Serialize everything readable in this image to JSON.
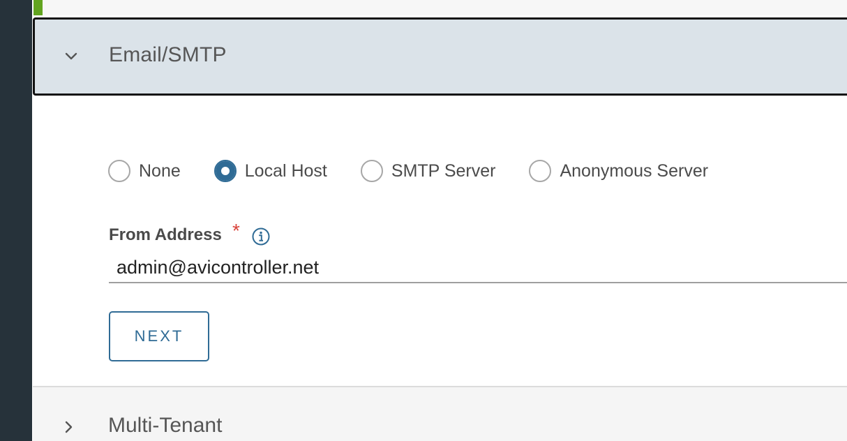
{
  "sections": {
    "email_smtp": {
      "title": "Email/SMTP",
      "expanded": true,
      "chevron_icon": "chevron-down-icon"
    },
    "multi_tenant": {
      "title": "Multi-Tenant",
      "expanded": false,
      "chevron_icon": "chevron-right-icon"
    }
  },
  "smtp_type": {
    "options": [
      {
        "label": "None",
        "selected": false
      },
      {
        "label": "Local Host",
        "selected": true
      },
      {
        "label": "SMTP Server",
        "selected": false
      },
      {
        "label": "Anonymous Server",
        "selected": false
      }
    ]
  },
  "from_address": {
    "label": "From Address",
    "required_mark": "*",
    "info_icon": "info-icon",
    "value": "admin@avicontroller.net"
  },
  "actions": {
    "next_label": "NEXT"
  },
  "colors": {
    "accent": "#2f6b95",
    "required": "#d9433b",
    "header_bg": "#dbe3e9",
    "rail": "#26323a",
    "status_strip": "#62a420"
  }
}
